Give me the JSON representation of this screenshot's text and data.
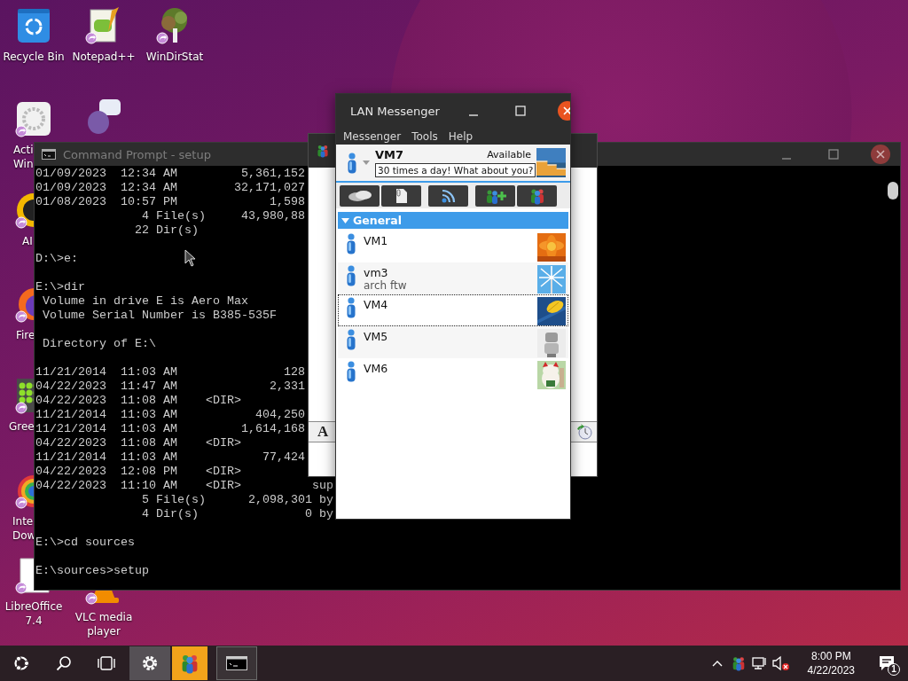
{
  "desktop": {
    "icons": [
      {
        "kind": "recycle",
        "lines": [
          "Recycle Bin"
        ]
      },
      {
        "kind": "notepad",
        "lines": [
          "Notepad++"
        ]
      },
      {
        "kind": "tree",
        "lines": [
          "WinDirStat"
        ]
      },
      {
        "kind": "gear",
        "lines": [
          "Acti",
          "Win"
        ]
      },
      {
        "kind": "bubble"
      },
      {
        "kind": "disc",
        "lines": [
          "AI"
        ]
      },
      {
        "kind": "globe",
        "lines": [
          "Fire"
        ]
      },
      {
        "kind": "dots",
        "lines": [
          "Gree"
        ]
      },
      {
        "kind": "rainbow",
        "lines": [
          "Inte",
          "Dow"
        ]
      },
      {
        "kind": "document",
        "lines": [
          "LibreOffice",
          "7.4"
        ]
      },
      {
        "kind": "cone",
        "lines": [
          "VLC media",
          "player"
        ]
      }
    ]
  },
  "command_prompt": {
    "title": "Command Prompt - setup",
    "blocks": [
      [
        "01/09/2023  12:34 AM         5,361,152",
        "01/09/2023  12:34 AM        32,171,027",
        "01/08/2023  10:57 PM             1,598",
        "               4 File(s)     43,980,88",
        "              22 Dir(s)"
      ],
      [
        "D:\\>e:"
      ],
      [
        "E:\\>dir",
        " Volume in drive E is Aero Max",
        " Volume Serial Number is B385-535F"
      ],
      [
        " Directory of E:\\"
      ],
      [
        "11/21/2014  11:03 AM               128",
        "04/22/2023  11:47 AM             2,331",
        "04/22/2023  11:08 AM    <DIR>",
        "11/21/2014  11:03 AM           404,250",
        "11/21/2014  11:03 AM         1,614,168",
        "04/22/2023  11:08 AM    <DIR>",
        "11/21/2014  11:03 AM            77,424",
        "04/22/2023  12:08 PM    <DIR>",
        "04/22/2023  11:10 AM    <DIR>          sup",
        "               5 File(s)      2,098,301 by",
        "               4 Dir(s)               0 by"
      ],
      [
        "E:\\>cd sources"
      ],
      [
        "E:\\sources>setup"
      ]
    ]
  },
  "chat_window": {
    "font_button": "A"
  },
  "lan_messenger": {
    "title": "LAN Messenger",
    "menu": [
      "Messenger",
      "Tools",
      "Help"
    ],
    "user": {
      "name": "VM7",
      "status": "Available",
      "note": "30 times a day! What about you?"
    },
    "groups": [
      {
        "name": "General",
        "expanded": true,
        "contacts": [
          {
            "name": "VM1",
            "selected": false
          },
          {
            "name": "vm3",
            "note": "arch ftw",
            "selected": false
          },
          {
            "name": "VM4",
            "selected": true
          },
          {
            "name": "VM5",
            "selected": false
          },
          {
            "name": "VM6",
            "selected": false
          }
        ]
      }
    ]
  },
  "taskbar": {
    "apps": [
      {
        "kind": "settings",
        "selected": false
      },
      {
        "kind": "messenger",
        "selected": true
      },
      {
        "kind": "terminal",
        "selected": false
      }
    ],
    "tray": {
      "muted": true,
      "time": "8:00 PM",
      "date": "4/22/2023",
      "notification_count": "1"
    }
  }
}
